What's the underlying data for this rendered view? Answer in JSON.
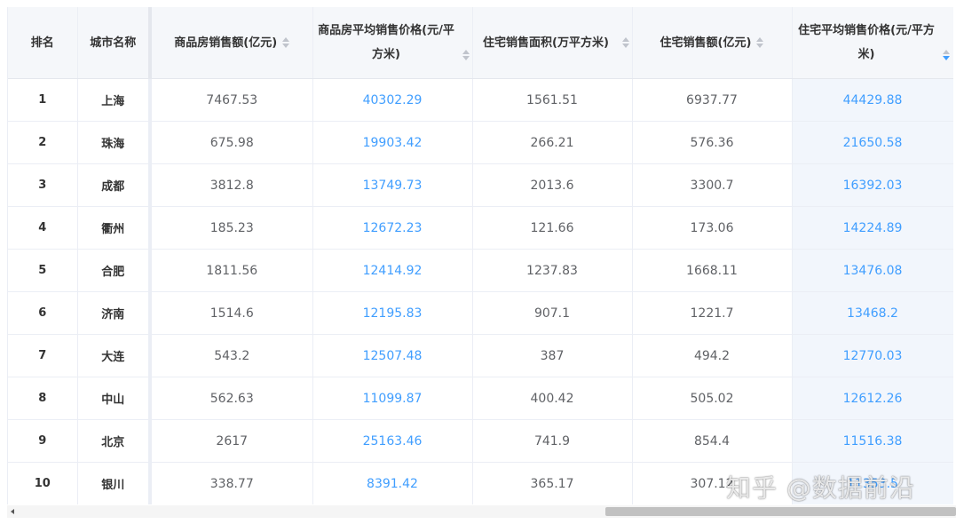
{
  "table": {
    "headers": [
      {
        "label": "排名",
        "sortable": false
      },
      {
        "label": "城市名称",
        "sortable": false
      },
      {
        "label": "商品房销售额(亿元)",
        "sortable": true
      },
      {
        "label": "商品房平均销售价格(元/平方米)",
        "sortable": true
      },
      {
        "label": "住宅销售面积(万平方米)",
        "sortable": true
      },
      {
        "label": "住宅销售额(亿元)",
        "sortable": true
      },
      {
        "label": "住宅平均销售价格(元/平方米)",
        "sortable": true,
        "sorted": "desc"
      }
    ],
    "rows": [
      [
        "1",
        "上海",
        "7467.53",
        "40302.29",
        "1561.51",
        "6937.77",
        "44429.88"
      ],
      [
        "2",
        "珠海",
        "675.98",
        "19903.42",
        "266.21",
        "576.36",
        "21650.58"
      ],
      [
        "3",
        "成都",
        "3812.8",
        "13749.73",
        "2013.6",
        "3300.7",
        "16392.03"
      ],
      [
        "4",
        "衢州",
        "185.23",
        "12672.23",
        "121.66",
        "173.06",
        "14224.89"
      ],
      [
        "5",
        "合肥",
        "1811.56",
        "12414.92",
        "1237.83",
        "1668.11",
        "13476.08"
      ],
      [
        "6",
        "济南",
        "1514.6",
        "12195.83",
        "907.1",
        "1221.7",
        "13468.2"
      ],
      [
        "7",
        "大连",
        "543.2",
        "12507.48",
        "387",
        "494.2",
        "12770.03"
      ],
      [
        "8",
        "中山",
        "562.63",
        "11099.87",
        "400.42",
        "505.02",
        "12612.26"
      ],
      [
        "9",
        "北京",
        "2617",
        "25163.46",
        "741.9",
        "854.4",
        "11516.38"
      ],
      [
        "10",
        "银川",
        "338.77",
        "8391.42",
        "365.17",
        "307.12",
        "11353.5"
      ]
    ]
  },
  "watermark": "知乎 @数据前沿",
  "colors": {
    "link": "#409eff",
    "header_bg": "#f5f7fa",
    "sorted_bg": "#f2f6fc"
  }
}
